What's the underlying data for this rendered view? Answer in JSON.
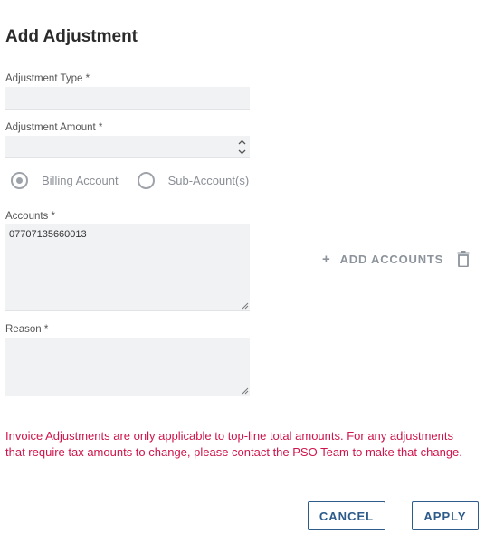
{
  "dialog": {
    "title": "Add Adjustment"
  },
  "fields": {
    "adjustment_type_label": "Adjustment Type *",
    "adjustment_type_value": "",
    "adjustment_amount_label": "Adjustment Amount *",
    "adjustment_amount_value": "",
    "account_scope": {
      "options": [
        "Billing Account",
        "Sub-Account(s)"
      ],
      "selected": "Billing Account"
    },
    "accounts_label": "Accounts *",
    "accounts_value": "07707135660013",
    "reason_label": "Reason *",
    "reason_value": ""
  },
  "actions": {
    "add_accounts_label": "ADD ACCOUNTS",
    "add_icon": "plus-icon",
    "delete_icon": "trash-icon",
    "cancel_label": "CANCEL",
    "apply_label": "APPLY"
  },
  "notice": {
    "text": "Invoice Adjustments are only applicable to top-line total amounts. For any adjustments that require tax amounts to change, please contact the PSO Team to make that change."
  },
  "colors": {
    "notice": "#d0144b",
    "button_border": "#2d5b8a",
    "field_bg": "#f1f2f4"
  }
}
